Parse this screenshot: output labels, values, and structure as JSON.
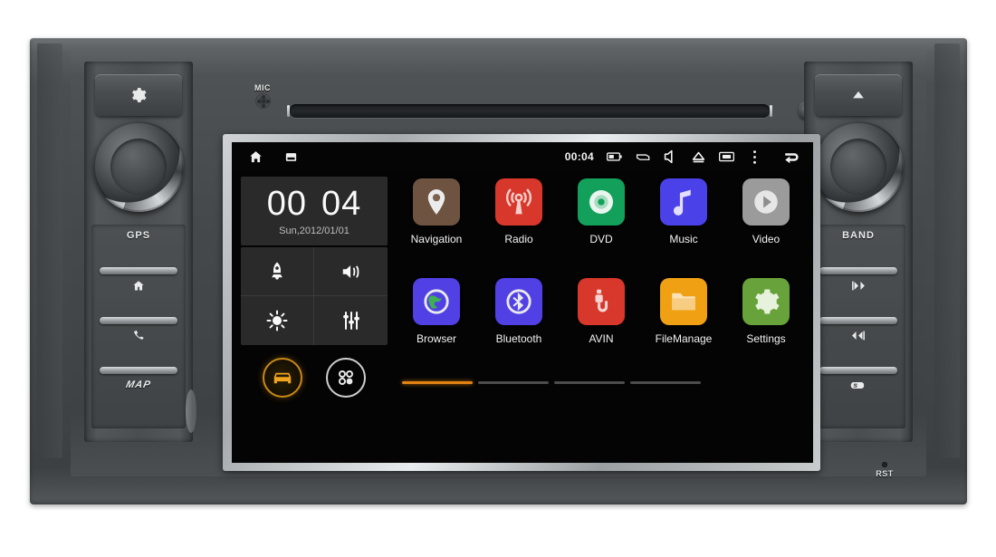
{
  "device": {
    "label_mic": "MIC",
    "label_reset": "RST",
    "left_keys": [
      {
        "label": "GPS",
        "icon": "gps-text"
      },
      {
        "label": "",
        "icon": "home-icon"
      },
      {
        "label": "",
        "icon": "phone-icon"
      },
      {
        "label": "MAP",
        "icon": "map-text"
      }
    ],
    "right_keys": [
      {
        "label": "BAND",
        "icon": "band-text"
      },
      {
        "label": "",
        "icon": "previous-track-icon"
      },
      {
        "label": "",
        "icon": "next-track-icon"
      },
      {
        "label": "",
        "icon": "sd-card-icon"
      }
    ],
    "left_top_button": {
      "name": "power-settings-button",
      "icon": "gear-icon"
    },
    "right_top_button": {
      "name": "eject-button",
      "icon": "eject-icon"
    }
  },
  "screen": {
    "statusbar": {
      "time": "00:04",
      "left_icons": [
        "home-icon",
        "recents-icon"
      ],
      "right_icons": [
        "battery-icon",
        "usb-icon",
        "volume-icon",
        "eject-icon",
        "sdcard-icon",
        "overflow-menu-icon"
      ],
      "back_icon": "back-icon"
    },
    "clock_widget": {
      "hours": "00",
      "minutes": "04",
      "date": "Sun,2012/01/01"
    },
    "quick_settings": [
      {
        "name": "boost-tile",
        "icon": "rocket-icon"
      },
      {
        "name": "volume-tile",
        "icon": "speaker-icon"
      },
      {
        "name": "brightness-tile",
        "icon": "brightness-icon"
      },
      {
        "name": "equalizer-tile",
        "icon": "sliders-icon"
      }
    ],
    "dock": [
      {
        "name": "car-mode-button",
        "icon": "car-icon",
        "active": true
      },
      {
        "name": "all-apps-button",
        "icon": "apps-grid-icon",
        "active": false
      }
    ],
    "apps": [
      [
        {
          "label": "Navigation",
          "icon": "map-pin-icon",
          "color": "#6e5341"
        },
        {
          "label": "Radio",
          "icon": "radio-waves-icon",
          "color": "#d8372b"
        },
        {
          "label": "DVD",
          "icon": "disc-icon",
          "color": "#12a05a"
        },
        {
          "label": "Music",
          "icon": "music-note-icon",
          "color": "#4b41e8"
        },
        {
          "label": "Video",
          "icon": "play-circle-icon",
          "color": "#9b9b9b"
        }
      ],
      [
        {
          "label": "Browser",
          "icon": "globe-icon",
          "color": "#5140e4"
        },
        {
          "label": "Bluetooth",
          "icon": "bluetooth-icon",
          "color": "#5140e4"
        },
        {
          "label": "AVIN",
          "icon": "avin-plug-icon",
          "color": "#d8372b"
        },
        {
          "label": "FileManage",
          "icon": "folder-icon",
          "color": "#f0a013"
        },
        {
          "label": "Settings",
          "icon": "gear-icon",
          "color": "#68a23a"
        }
      ]
    ],
    "pager": {
      "pages": 4,
      "active_index": 0,
      "active_color": "#e08214"
    }
  }
}
